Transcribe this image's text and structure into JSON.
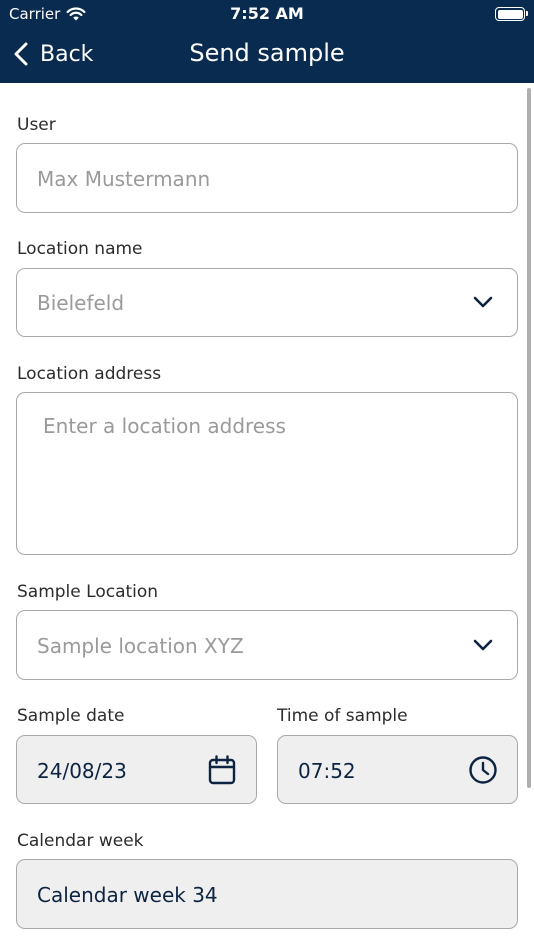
{
  "status_bar": {
    "carrier": "Carrier",
    "time": "7:52 AM"
  },
  "nav": {
    "back_label": "Back",
    "title": "Send sample"
  },
  "form": {
    "user": {
      "label": "User",
      "placeholder": "Max Mustermann"
    },
    "location_name": {
      "label": "Location name",
      "value": "Bielefeld"
    },
    "location_address": {
      "label": "Location address",
      "placeholder": "Enter a location address"
    },
    "sample_location": {
      "label": "Sample Location",
      "value": "Sample location XYZ"
    },
    "sample_date": {
      "label": "Sample date",
      "value": "24/08/23"
    },
    "time_of_sample": {
      "label": "Time of sample",
      "value": "07:52"
    },
    "calendar_week": {
      "label": "Calendar week",
      "value": "Calendar week 34"
    }
  },
  "icons": {
    "wifi": "wifi-icon",
    "battery": "battery-icon",
    "back": "chevron-left-icon",
    "dropdown": "chevron-down-icon",
    "calendar": "calendar-icon",
    "clock": "clock-icon"
  },
  "colors": {
    "header_bg": "#0a2b50",
    "accent": "#0c2442",
    "field_border": "#a9a9a9"
  }
}
